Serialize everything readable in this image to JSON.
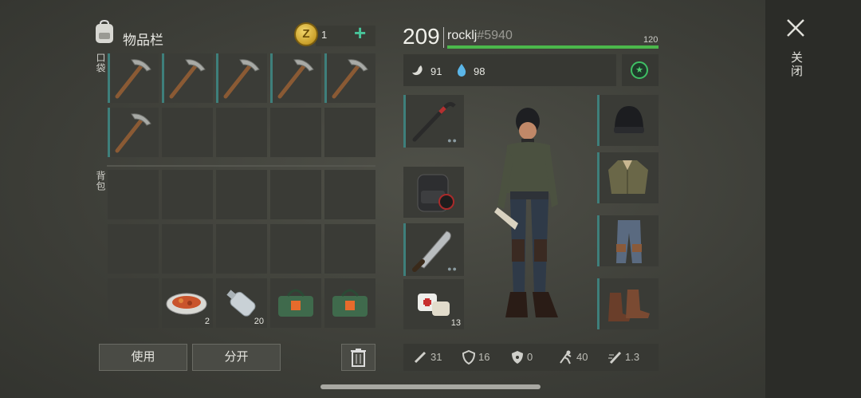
{
  "inventory": {
    "title": "物品栏",
    "coins": "1",
    "pocket_label": "口袋",
    "backpack_label": "背包",
    "items": {
      "food_qty": "2",
      "water_qty": "20"
    },
    "use_button": "使用",
    "split_button": "分开"
  },
  "player": {
    "level": "209",
    "username": "rocklj",
    "user_id": "#5940",
    "hp_max": "120",
    "hunger": "91",
    "thirst": "98"
  },
  "equipment": {
    "medkit_qty": "13"
  },
  "stats": {
    "attack": "31",
    "defense": "16",
    "radiation": "0",
    "speed": "40",
    "attack_speed": "1.3"
  },
  "close_label": "关闭",
  "colors": {
    "accent_teal": "#3e7f7b",
    "hp_green": "#4bb84b",
    "plus_green": "#48c49a"
  }
}
